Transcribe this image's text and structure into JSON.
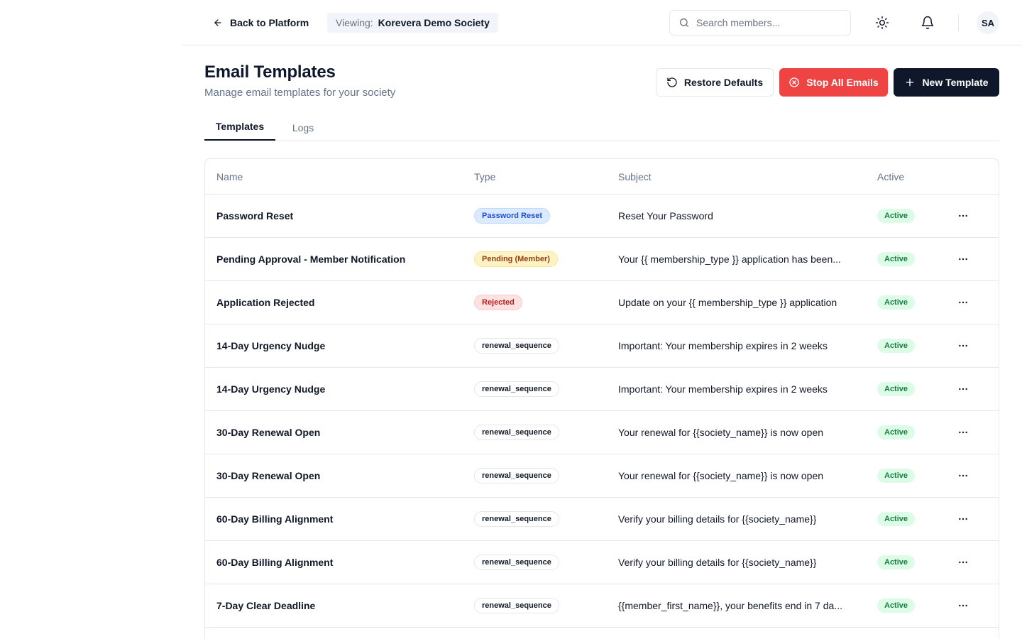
{
  "header": {
    "back_label": "Back to Platform",
    "viewing_label": "Viewing:",
    "viewing_value": "Korevera Demo Society",
    "search_placeholder": "Search members...",
    "avatar_initials": "SA"
  },
  "page": {
    "title": "Email Templates",
    "subtitle": "Manage email templates for your society"
  },
  "actions": {
    "restore_label": "Restore Defaults",
    "stop_label": "Stop All Emails",
    "new_label": "New Template"
  },
  "tabs": [
    {
      "label": "Templates",
      "selected": true
    },
    {
      "label": "Logs",
      "selected": false
    }
  ],
  "table": {
    "columns": [
      "Name",
      "Type",
      "Subject",
      "Active"
    ],
    "rows": [
      {
        "name": "Password Reset",
        "type": "Password Reset",
        "type_style": "blue",
        "subject": "Reset Your Password",
        "active": "Active"
      },
      {
        "name": "Pending Approval - Member Notification",
        "type": "Pending (Member)",
        "type_style": "yellow",
        "subject": "Your {{ membership_type }} application has been...",
        "active": "Active"
      },
      {
        "name": "Application Rejected",
        "type": "Rejected",
        "type_style": "red",
        "subject": "Update on your {{ membership_type }} application",
        "active": "Active"
      },
      {
        "name": "14-Day Urgency Nudge",
        "type": "renewal_sequence",
        "type_style": "outline",
        "subject": "Important: Your membership expires in 2 weeks",
        "active": "Active"
      },
      {
        "name": "14-Day Urgency Nudge",
        "type": "renewal_sequence",
        "type_style": "outline",
        "subject": "Important: Your membership expires in 2 weeks",
        "active": "Active"
      },
      {
        "name": "30-Day Renewal Open",
        "type": "renewal_sequence",
        "type_style": "outline",
        "subject": "Your renewal for {{society_name}} is now open",
        "active": "Active"
      },
      {
        "name": "30-Day Renewal Open",
        "type": "renewal_sequence",
        "type_style": "outline",
        "subject": "Your renewal for {{society_name}} is now open",
        "active": "Active"
      },
      {
        "name": "60-Day Billing Alignment",
        "type": "renewal_sequence",
        "type_style": "outline",
        "subject": "Verify your billing details for {{society_name}}",
        "active": "Active"
      },
      {
        "name": "60-Day Billing Alignment",
        "type": "renewal_sequence",
        "type_style": "outline",
        "subject": "Verify your billing details for {{society_name}}",
        "active": "Active"
      },
      {
        "name": "7-Day Clear Deadline",
        "type": "renewal_sequence",
        "type_style": "outline",
        "subject": "{{member_first_name}}, your benefits end in 7 da...",
        "active": "Active"
      }
    ]
  },
  "colors": {
    "danger": "#ef4444",
    "primary": "#0f172a",
    "active_bg": "#dcfce7",
    "active_text": "#15803d"
  }
}
